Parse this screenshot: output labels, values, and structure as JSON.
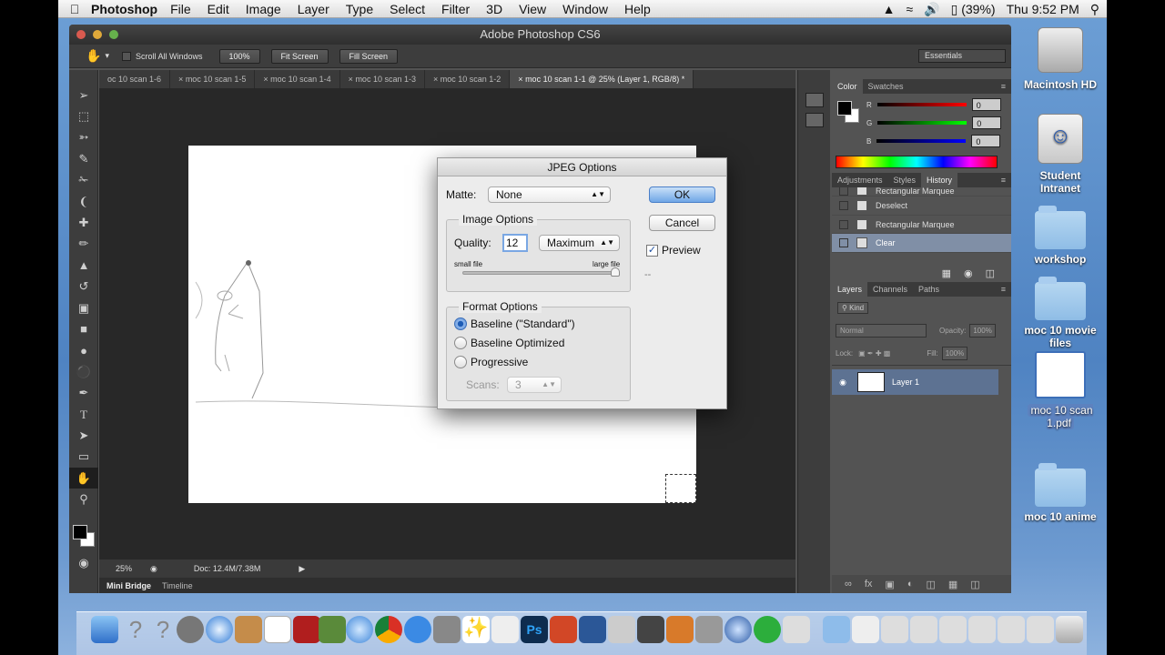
{
  "menubar": {
    "apple": "",
    "app": "Photoshop",
    "items": [
      "File",
      "Edit",
      "Image",
      "Layer",
      "Type",
      "Select",
      "Filter",
      "3D",
      "View",
      "Window",
      "Help"
    ],
    "battery": "(39%)",
    "clock": "Thu 9:52 PM"
  },
  "window": {
    "title": "Adobe Photoshop CS6"
  },
  "options": {
    "scroll_all": "Scroll All Windows",
    "zoom": "100%",
    "fit": "Fit Screen",
    "fill": "Fill Screen",
    "workspace": "Essentials"
  },
  "tabs": [
    "oc 10 scan 1-6",
    "moc 10 scan 1-5",
    "moc 10 scan 1-4",
    "moc 10 scan 1-3",
    "moc 10 scan 1-2",
    "moc 10 scan 1-1 @ 25% (Layer 1, RGB/8) *"
  ],
  "status": {
    "zoom": "25%",
    "doc": "Doc: 12.4M/7.38M"
  },
  "bottom_tabs": {
    "minibridge": "Mini Bridge",
    "timeline": "Timeline"
  },
  "color_panel": {
    "tabs": [
      "Color",
      "Swatches"
    ],
    "channels": [
      {
        "label": "R",
        "value": "0"
      },
      {
        "label": "G",
        "value": "0"
      },
      {
        "label": "B",
        "value": "0"
      }
    ]
  },
  "history_panel": {
    "tabs": [
      "Adjustments",
      "Styles",
      "History"
    ],
    "items": [
      "Rectangular Marquee",
      "Deselect",
      "Rectangular Marquee",
      "Clear"
    ]
  },
  "layers_panel": {
    "tabs": [
      "Layers",
      "Channels",
      "Paths"
    ],
    "kind": "Kind",
    "blend": "Normal",
    "opacity_label": "Opacity:",
    "opacity": "100%",
    "lock_label": "Lock:",
    "fill_label": "Fill:",
    "fill": "100%",
    "layer": "Layer 1"
  },
  "dialog": {
    "title": "JPEG Options",
    "matte_label": "Matte:",
    "matte": "None",
    "ok": "OK",
    "cancel": "Cancel",
    "preview": "Preview",
    "preview_size": "--",
    "image_options": "Image Options",
    "quality_label": "Quality:",
    "quality": "12",
    "quality_preset": "Maximum",
    "small_file": "small file",
    "large_file": "large file",
    "format_options": "Format Options",
    "formats": [
      "Baseline (\"Standard\")",
      "Baseline Optimized",
      "Progressive"
    ],
    "scans_label": "Scans:",
    "scans": "3"
  },
  "desktop": {
    "items": [
      "Macintosh HD",
      "Student Intranet",
      "workshop",
      "moc 10 movie files",
      "moc 10 scan 1.pdf",
      "moc 10 anime"
    ]
  }
}
